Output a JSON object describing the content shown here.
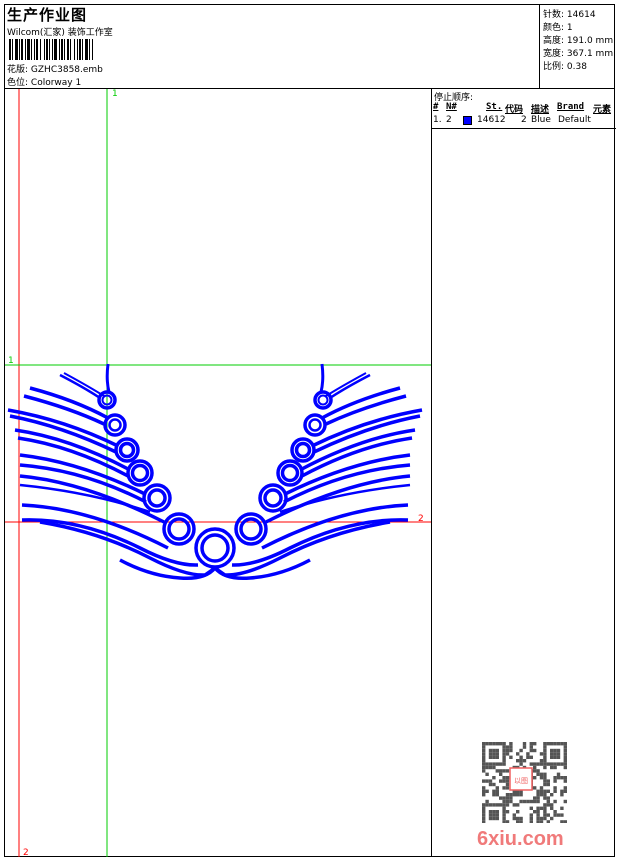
{
  "header": {
    "title": "生产作业图",
    "company": "Wilcom(汇家) 装饰工作室",
    "design_label": "花版:",
    "design_value": "GZHC3858.emb",
    "colorway_label": "色位:",
    "colorway_value": "Colorway 1"
  },
  "info": {
    "stitches": {
      "label": "针数:",
      "value": "14614"
    },
    "colors": {
      "label": "颜色:",
      "value": "1"
    },
    "height": {
      "label": "高度:",
      "value": "191.0 mm"
    },
    "width": {
      "label": "宽度:",
      "value": "367.1 mm"
    },
    "scale": {
      "label": "比例:",
      "value": "0.38"
    }
  },
  "stop_sequence": {
    "label": "停止顺序:",
    "columns": [
      "#",
      "N#",
      "St.",
      "代码",
      "描述",
      "Brand",
      "元素"
    ],
    "rows": [
      {
        "index": "1.",
        "needle": "2",
        "color": "#0000ff",
        "stitches": "14612",
        "code": "2",
        "description": "Blue",
        "brand": "Default",
        "element": ""
      }
    ]
  },
  "guides": {
    "v1": "1",
    "h1": "1",
    "h2": "2",
    "v2": "2"
  },
  "colors": {
    "thread": "#0000ff",
    "guide_green": "#00cc00",
    "guide_red": "#ff0000"
  },
  "watermark": {
    "site": "6xiu.com",
    "seal": "以图制版"
  }
}
